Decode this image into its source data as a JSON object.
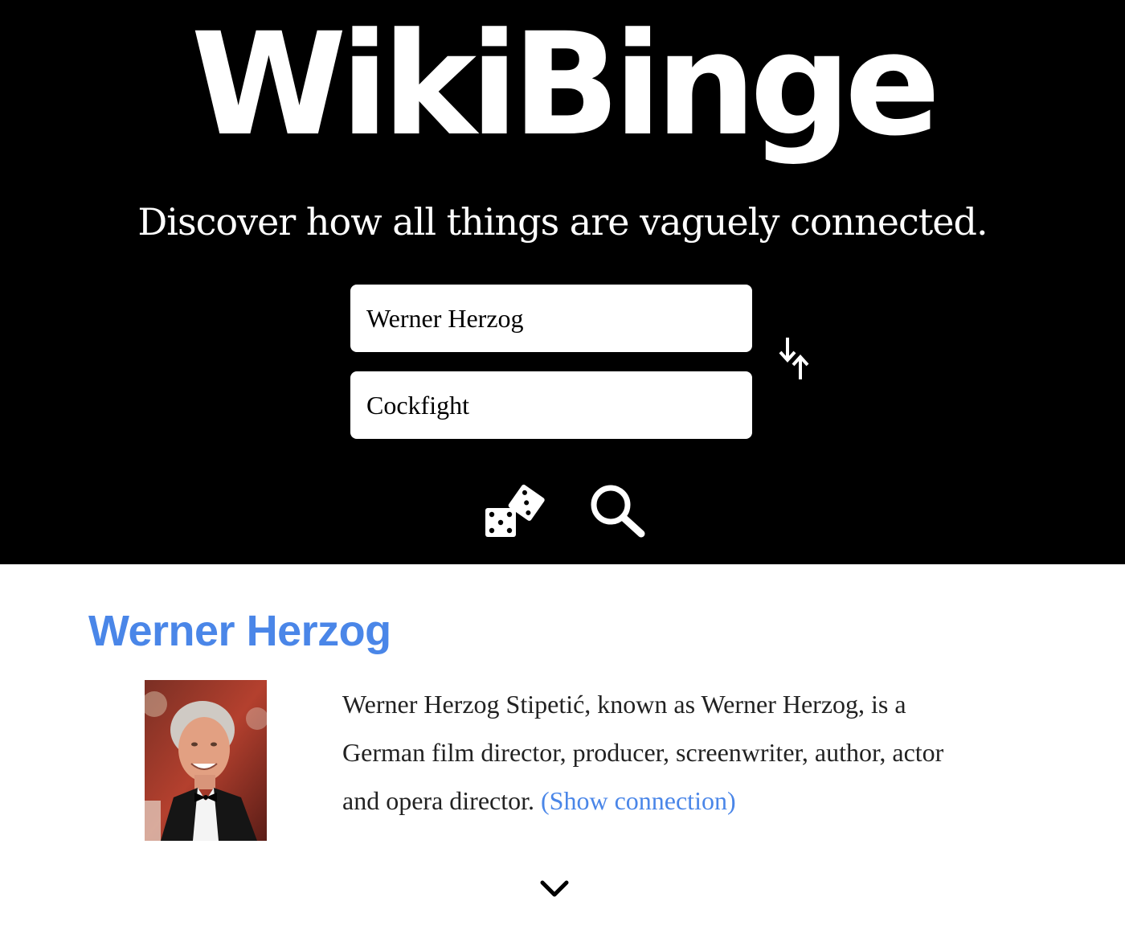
{
  "header": {
    "logo": "WikiBinge",
    "tagline": "Discover how all things are vaguely connected.",
    "background_color": "#000000",
    "text_color": "#ffffff"
  },
  "search": {
    "from_value": "Werner Herzog",
    "to_value": "Cockfight",
    "swap_icon": "swap-arrows-icon",
    "random_icon": "dice-icon",
    "search_icon": "magnifier-icon"
  },
  "result": {
    "title": "Werner Herzog",
    "description": "Werner Herzog Stipetić, known as Werner Herzog, is a German film director, producer, screenwriter, author, actor and opera director.",
    "show_connection_label": "(Show connection)",
    "photo_icon": "portrait-photo",
    "expand_icon": "chevron-down-icon",
    "link_color": "#4a86e8"
  }
}
